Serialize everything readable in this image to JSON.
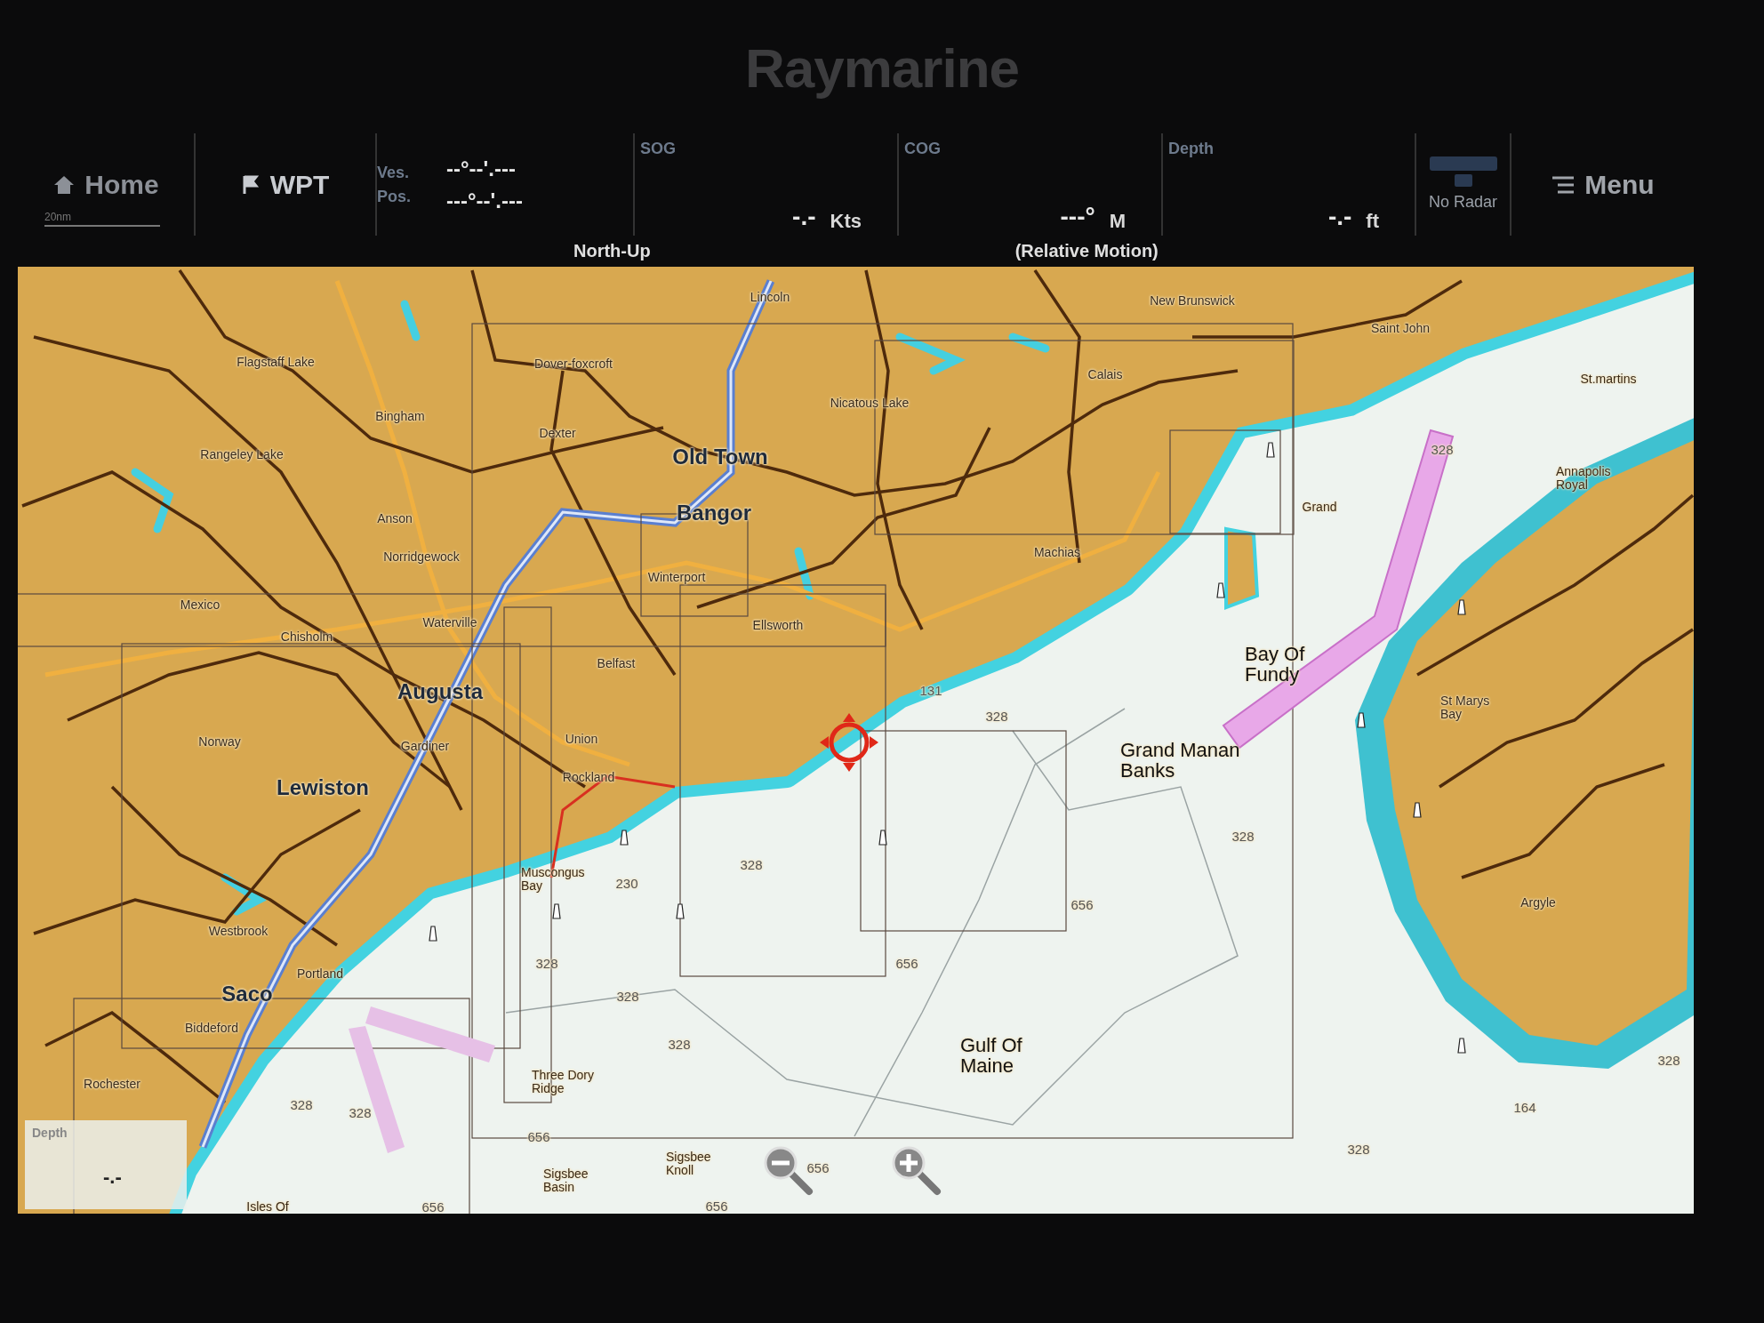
{
  "brand": "Raymarine",
  "toolbar": {
    "home": "Home",
    "waypoint": "WPT",
    "position": {
      "label_top": "Ves.",
      "label_bottom": "Pos.",
      "latitude": "--°--'.---",
      "longitude": "---°--'.---"
    },
    "readouts": [
      {
        "label": "SOG",
        "value": "-.-",
        "unit": "Kts"
      },
      {
        "label": "COG",
        "value": "---°",
        "unit": "M"
      },
      {
        "label": "Depth",
        "value": "-.-",
        "unit": "ft"
      }
    ],
    "radar": "No Radar",
    "menu": "Menu",
    "orientation": "North-Up",
    "motion_mode": "(Relative Motion)"
  },
  "chart": {
    "scale": "20nm",
    "place_labels": [
      {
        "text": "Old Town",
        "kind": "major"
      },
      {
        "text": "Bangor",
        "kind": "major"
      },
      {
        "text": "Augusta",
        "kind": "major"
      },
      {
        "text": "Lewiston",
        "kind": "major"
      },
      {
        "text": "Saco",
        "kind": "major"
      },
      {
        "text": "Grand Manan Banks",
        "kind": "sea"
      },
      {
        "text": "Bay Of Fundy",
        "kind": "sea"
      },
      {
        "text": "Gulf Of Maine",
        "kind": "sea"
      },
      {
        "text": "Lincoln",
        "kind": "minor"
      },
      {
        "text": "Dover-foxcroft",
        "kind": "minor"
      },
      {
        "text": "Dexter",
        "kind": "minor"
      },
      {
        "text": "Nicatous Lake",
        "kind": "minor"
      },
      {
        "text": "Flagstaff Lake",
        "kind": "minor"
      },
      {
        "text": "Bingham",
        "kind": "minor"
      },
      {
        "text": "Rangeley Lake",
        "kind": "minor"
      },
      {
        "text": "Anson",
        "kind": "minor"
      },
      {
        "text": "Norridgewock",
        "kind": "minor"
      },
      {
        "text": "Waterville",
        "kind": "minor"
      },
      {
        "text": "Mexico",
        "kind": "minor"
      },
      {
        "text": "Chisholm",
        "kind": "minor"
      },
      {
        "text": "Winterport",
        "kind": "minor"
      },
      {
        "text": "Ellsworth",
        "kind": "minor"
      },
      {
        "text": "Belfast",
        "kind": "minor"
      },
      {
        "text": "Union",
        "kind": "minor"
      },
      {
        "text": "Rockland",
        "kind": "minor"
      },
      {
        "text": "Norway",
        "kind": "minor"
      },
      {
        "text": "Gardiner",
        "kind": "minor"
      },
      {
        "text": "Westbrook",
        "kind": "minor"
      },
      {
        "text": "Portland",
        "kind": "minor"
      },
      {
        "text": "Biddeford",
        "kind": "minor"
      },
      {
        "text": "Rochester",
        "kind": "minor"
      },
      {
        "text": "Muscongus Bay",
        "kind": "minor"
      },
      {
        "text": "Three Dory Ridge",
        "kind": "minor"
      },
      {
        "text": "Sigsbee Knoll",
        "kind": "minor"
      },
      {
        "text": "Sigsbee Basin",
        "kind": "minor"
      },
      {
        "text": "Isles Of",
        "kind": "minor"
      },
      {
        "text": "New Brunswick",
        "kind": "minor"
      },
      {
        "text": "Saint John",
        "kind": "minor"
      },
      {
        "text": "St.martins",
        "kind": "minor"
      },
      {
        "text": "Calais",
        "kind": "minor"
      },
      {
        "text": "Machias",
        "kind": "minor"
      },
      {
        "text": "Grand",
        "kind": "minor"
      },
      {
        "text": "Annapolis Royal",
        "kind": "minor"
      },
      {
        "text": "St Marys Bay",
        "kind": "minor"
      },
      {
        "text": "Argyle",
        "kind": "minor"
      },
      {
        "text": "328",
        "kind": "depth"
      },
      {
        "text": "131",
        "kind": "depth"
      },
      {
        "text": "328",
        "kind": "depth"
      },
      {
        "text": "328",
        "kind": "depth"
      },
      {
        "text": "656",
        "kind": "depth"
      },
      {
        "text": "656",
        "kind": "depth"
      },
      {
        "text": "328",
        "kind": "depth"
      },
      {
        "text": "230",
        "kind": "depth"
      },
      {
        "text": "328",
        "kind": "depth"
      },
      {
        "text": "328",
        "kind": "depth"
      },
      {
        "text": "328",
        "kind": "depth"
      },
      {
        "text": "328",
        "kind": "depth"
      },
      {
        "text": "328",
        "kind": "depth"
      },
      {
        "text": "656",
        "kind": "depth"
      },
      {
        "text": "656",
        "kind": "depth"
      },
      {
        "text": "656",
        "kind": "depth"
      },
      {
        "text": "656",
        "kind": "depth"
      },
      {
        "text": "164",
        "kind": "depth"
      },
      {
        "text": "328",
        "kind": "depth"
      },
      {
        "text": "328",
        "kind": "depth"
      }
    ],
    "depth_box": {
      "label": "Depth",
      "value": "-.-"
    }
  }
}
